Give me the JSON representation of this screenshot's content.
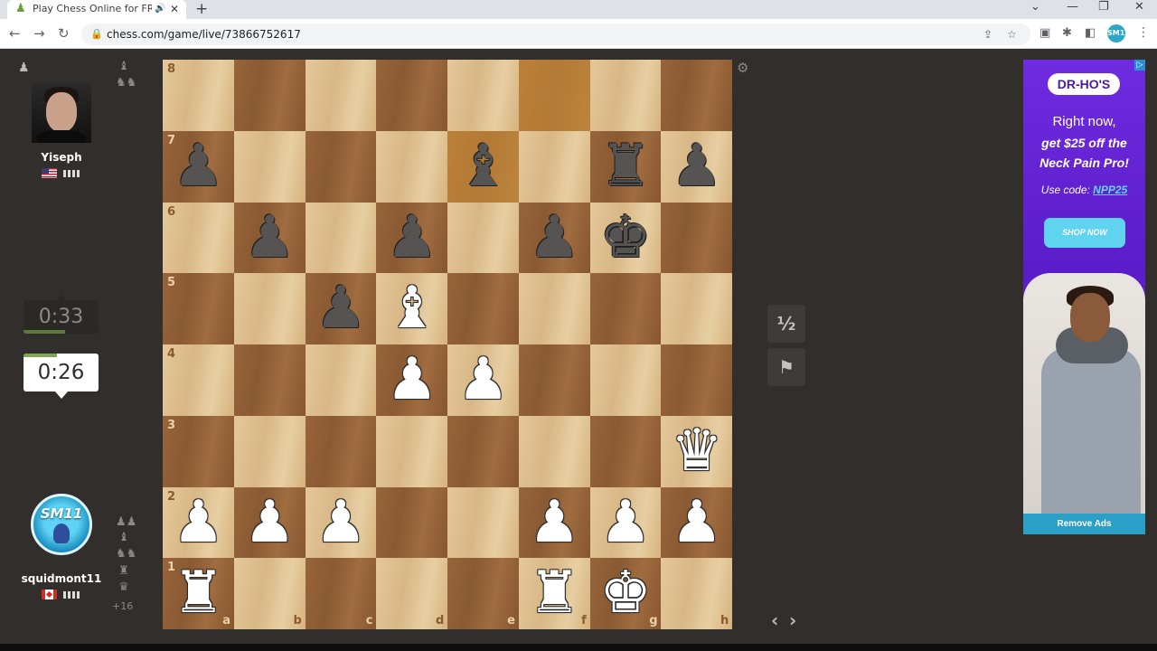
{
  "browser": {
    "tab_title": "Play Chess Online for FREE w",
    "url": "chess.com/game/live/73866752617",
    "new_tab_glyph": "+",
    "profile_label": "SM11"
  },
  "top_player": {
    "name": "Yiseph",
    "country": "US",
    "clock": "0:33",
    "clock_progress": 0.55,
    "captured": [
      "♝",
      "♞♞"
    ]
  },
  "bottom_player": {
    "name": "squidmont11",
    "country": "CA",
    "clock": "0:26",
    "clock_progress": 0.45,
    "avatar_text": "SM11",
    "captured": [
      "♟♟",
      "♝",
      "♞♞",
      "♜",
      "♛"
    ],
    "material_advantage": "+16"
  },
  "board": {
    "files": [
      "a",
      "b",
      "c",
      "d",
      "e",
      "f",
      "g",
      "h"
    ],
    "ranks": [
      "8",
      "7",
      "6",
      "5",
      "4",
      "3",
      "2",
      "1"
    ],
    "highlight": [
      "e7",
      "f8"
    ],
    "pieces": [
      {
        "sq": "a7",
        "color": "b",
        "glyph": "♟",
        "name": "black-pawn"
      },
      {
        "sq": "e7",
        "color": "b",
        "glyph": "♝",
        "name": "black-bishop"
      },
      {
        "sq": "g7",
        "color": "b",
        "glyph": "♜",
        "name": "black-rook"
      },
      {
        "sq": "h7",
        "color": "b",
        "glyph": "♟",
        "name": "black-pawn"
      },
      {
        "sq": "b6",
        "color": "b",
        "glyph": "♟",
        "name": "black-pawn"
      },
      {
        "sq": "d6",
        "color": "b",
        "glyph": "♟",
        "name": "black-pawn"
      },
      {
        "sq": "f6",
        "color": "b",
        "glyph": "♟",
        "name": "black-pawn"
      },
      {
        "sq": "g6",
        "color": "b",
        "glyph": "♚",
        "name": "black-king"
      },
      {
        "sq": "c5",
        "color": "b",
        "glyph": "♟",
        "name": "black-pawn"
      },
      {
        "sq": "d5",
        "color": "w",
        "glyph": "♝",
        "name": "white-bishop"
      },
      {
        "sq": "d4",
        "color": "w",
        "glyph": "♟",
        "name": "white-pawn"
      },
      {
        "sq": "e4",
        "color": "w",
        "glyph": "♟",
        "name": "white-pawn"
      },
      {
        "sq": "h3",
        "color": "w",
        "glyph": "♛",
        "name": "white-queen"
      },
      {
        "sq": "a2",
        "color": "w",
        "glyph": "♟",
        "name": "white-pawn"
      },
      {
        "sq": "b2",
        "color": "w",
        "glyph": "♟",
        "name": "white-pawn"
      },
      {
        "sq": "c2",
        "color": "w",
        "glyph": "♟",
        "name": "white-pawn"
      },
      {
        "sq": "f2",
        "color": "w",
        "glyph": "♟",
        "name": "white-pawn"
      },
      {
        "sq": "g2",
        "color": "w",
        "glyph": "♟",
        "name": "white-pawn"
      },
      {
        "sq": "h2",
        "color": "w",
        "glyph": "♟",
        "name": "white-pawn"
      },
      {
        "sq": "a1",
        "color": "w",
        "glyph": "♜",
        "name": "white-rook"
      },
      {
        "sq": "f1",
        "color": "w",
        "glyph": "♜",
        "name": "white-rook"
      },
      {
        "sq": "g1",
        "color": "w",
        "glyph": "♚",
        "name": "white-king"
      }
    ]
  },
  "controls": {
    "draw_label": "½",
    "resign_glyph": "⚑",
    "prev_glyph": "‹",
    "next_glyph": "›"
  },
  "ad": {
    "brand": "DR-HO'S",
    "line1": "Right now,",
    "line2": "get $25 off the",
    "line3": "Neck Pain Pro!",
    "code_prefix": "Use code: ",
    "code": "NPP25",
    "cta": "SHOP NOW",
    "remove": "Remove Ads"
  }
}
